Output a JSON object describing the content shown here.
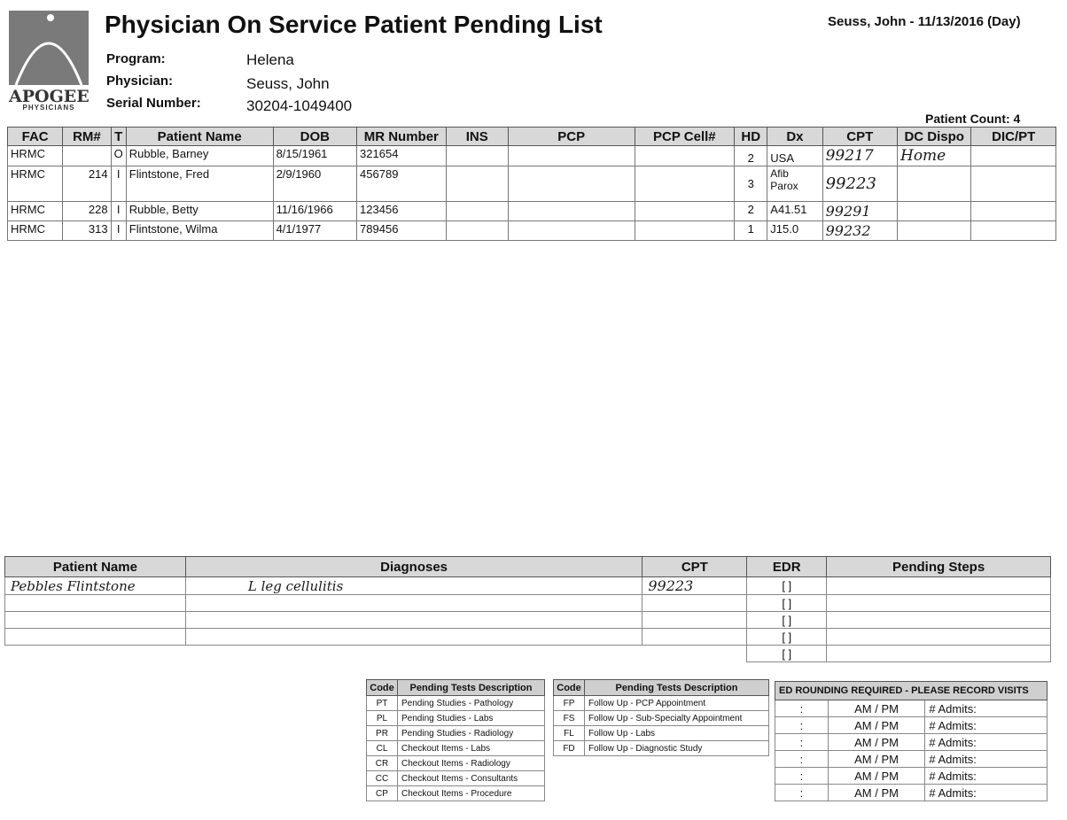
{
  "logo": {
    "word": "APOGEE",
    "sub": "PHYSICIANS"
  },
  "title": "Physician On Service Patient Pending List",
  "header_right": "Seuss, John  -  11/13/2016 (Day)",
  "meta": {
    "program_label": "Program:",
    "program": "Helena",
    "physician_label": "Physician:",
    "physician": "Seuss, John",
    "serial_label": "Serial Number:",
    "serial": "30204-1049400"
  },
  "patient_count": "Patient Count: 4",
  "main_table": {
    "headers": [
      "FAC",
      "RM#",
      "T",
      "Patient Name",
      "DOB",
      "MR Number",
      "INS",
      "PCP",
      "PCP Cell#",
      "HD",
      "Dx",
      "CPT",
      "DC Dispo",
      "DIC/PT"
    ],
    "rows": [
      {
        "fac": "HRMC",
        "rm": "",
        "t": "O",
        "name": "Rubble, Barney",
        "dob": "8/15/1961",
        "mr": "321654",
        "hd": "2",
        "dx": "USA",
        "cpt": "99217",
        "dispo": "Home"
      },
      {
        "fac": "HRMC",
        "rm": "214",
        "t": "I",
        "name": "Flintstone, Fred",
        "dob": "2/9/1960",
        "mr": "456789",
        "hd": "3",
        "dx": "Afib Parox",
        "cpt": "99223",
        "dispo": ""
      },
      {
        "fac": "HRMC",
        "rm": "228",
        "t": "I",
        "name": "Rubble, Betty",
        "dob": "11/16/1966",
        "mr": "123456",
        "hd": "2",
        "dx": "A41.51",
        "cpt": "99291",
        "dispo": ""
      },
      {
        "fac": "HRMC",
        "rm": "313",
        "t": "I",
        "name": "Flintstone, Wilma",
        "dob": "4/1/1977",
        "mr": "789456",
        "hd": "1",
        "dx": "J15.0",
        "cpt": "99232",
        "dispo": ""
      }
    ]
  },
  "pending_table": {
    "headers": [
      "Patient Name",
      "Diagnoses",
      "CPT",
      "EDR",
      "Pending Steps"
    ],
    "rows": [
      {
        "name": "Pebbles Flintstone",
        "diagnoses": "L leg cellulitis",
        "cpt": "99223",
        "edr": "[ ]"
      },
      {
        "name": "",
        "diagnoses": "",
        "cpt": "",
        "edr": "[ ]"
      },
      {
        "name": "",
        "diagnoses": "",
        "cpt": "",
        "edr": "[ ]"
      },
      {
        "name": "",
        "diagnoses": "",
        "cpt": "",
        "edr": "[ ]"
      },
      {
        "name": "",
        "diagnoses": "",
        "cpt": "",
        "edr": "[ ]"
      }
    ]
  },
  "codes_left": {
    "headers": [
      "Code",
      "Pending Tests Description"
    ],
    "rows": [
      [
        "PT",
        "Pending Studies - Pathology"
      ],
      [
        "PL",
        "Pending Studies - Labs"
      ],
      [
        "PR",
        "Pending Studies - Radiology"
      ],
      [
        "CL",
        "Checkout Items - Labs"
      ],
      [
        "CR",
        "Checkout Items - Radiology"
      ],
      [
        "CC",
        "Checkout Items - Consultants"
      ],
      [
        "CP",
        "Checkout Items - Procedure"
      ]
    ]
  },
  "codes_right": {
    "headers": [
      "Code",
      "Pending Tests Description"
    ],
    "rows": [
      [
        "FP",
        "Follow Up - PCP Appointment"
      ],
      [
        "FS",
        "Follow Up - Sub-Specialty Appointment"
      ],
      [
        "FL",
        "Follow Up - Labs"
      ],
      [
        "FD",
        "Follow Up - Diagnostic Study"
      ]
    ]
  },
  "rounding": {
    "header": "ED ROUNDING REQUIRED - PLEASE RECORD VISITS",
    "colon": ":",
    "ampm": "AM / PM",
    "admits": "# Admits:",
    "count": 6
  }
}
